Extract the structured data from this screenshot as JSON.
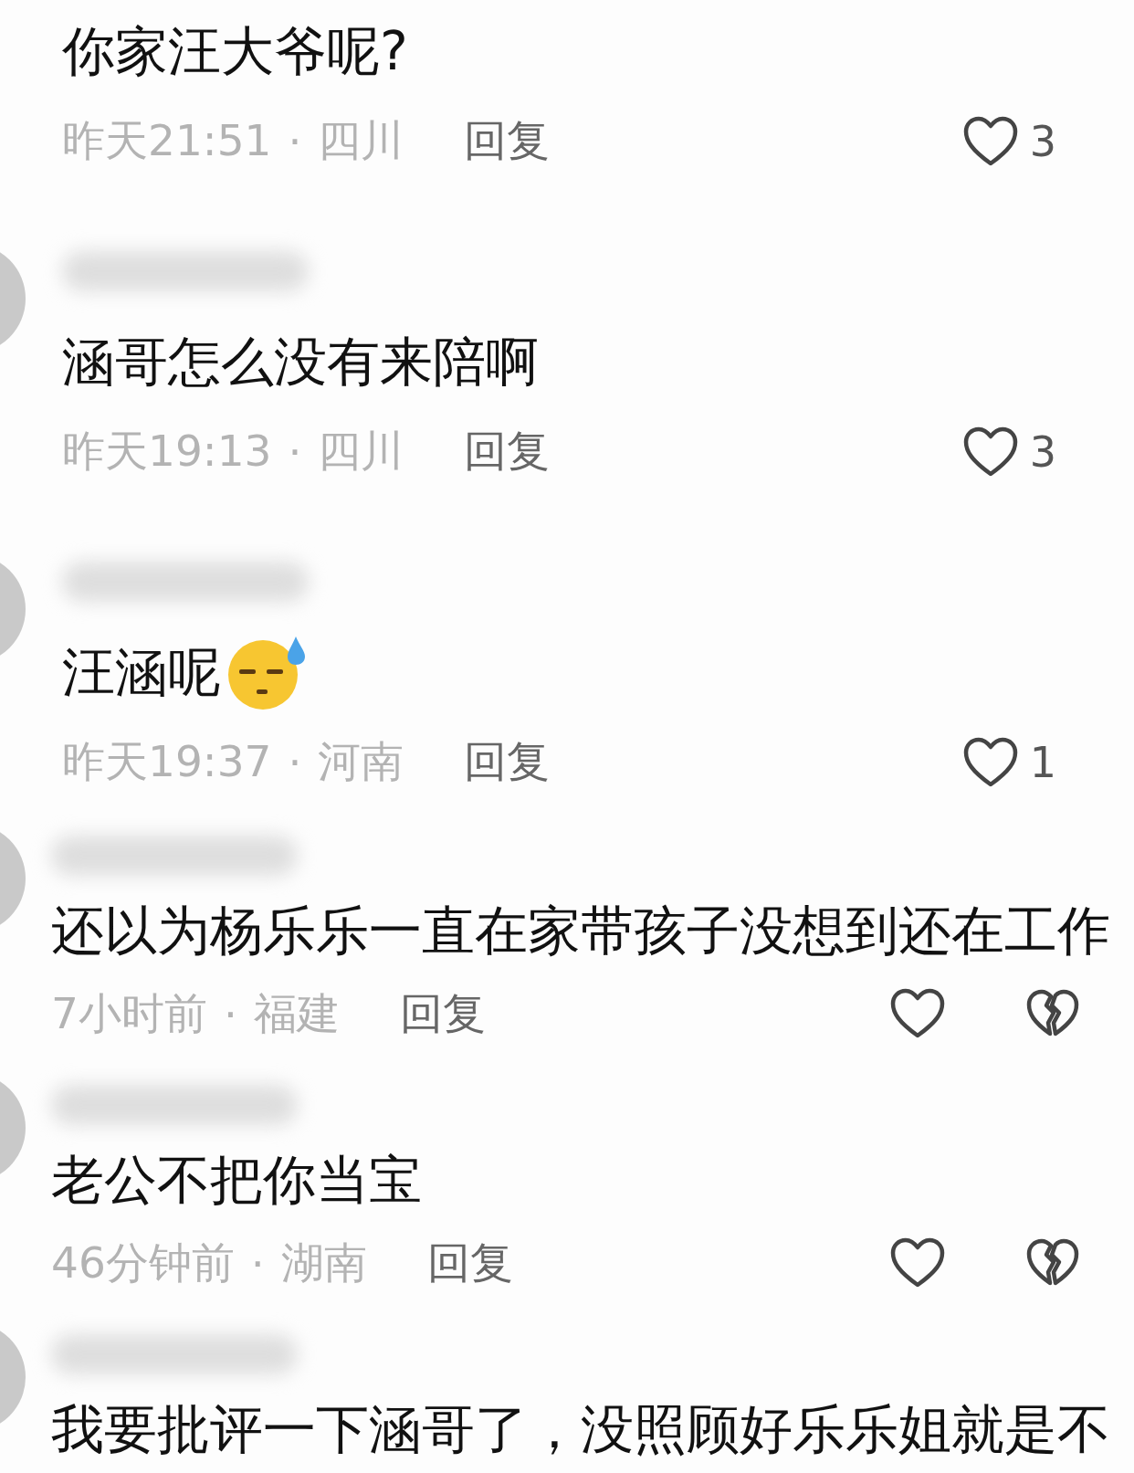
{
  "comments": [
    {
      "kind": "classic",
      "text": "你家汪大爷呢?",
      "time": "昨天21:51",
      "separator": "·",
      "location": "四川",
      "reply": "回复",
      "likes": "3"
    },
    {
      "kind": "classic",
      "name_blurred": true,
      "text": "涵哥怎么没有来陪啊",
      "time": "昨天19:13",
      "separator": "·",
      "location": "四川",
      "reply": "回复",
      "likes": "3"
    },
    {
      "kind": "classic",
      "name_blurred": true,
      "text": "汪涵呢",
      "time": "昨天19:37",
      "separator": "·",
      "location": "河南",
      "reply": "回复",
      "likes": "1",
      "emoji": true
    },
    {
      "kind": "two_hearts",
      "name_blurred": true,
      "text": "还以为杨乐乐一直在家带孩子没想到还在工作",
      "time": "7小时前",
      "separator": "·",
      "location": "福建",
      "reply": "回复"
    },
    {
      "kind": "two_hearts",
      "name_blurred": true,
      "text": "老公不把你当宝",
      "time": "46分钟前",
      "separator": "·",
      "location": "湖南",
      "reply": "回复"
    },
    {
      "kind": "two_hearts",
      "name_blurred": true,
      "text": "我要批评一下涵哥了，没照顾好乐乐姐就是不"
    }
  ]
}
